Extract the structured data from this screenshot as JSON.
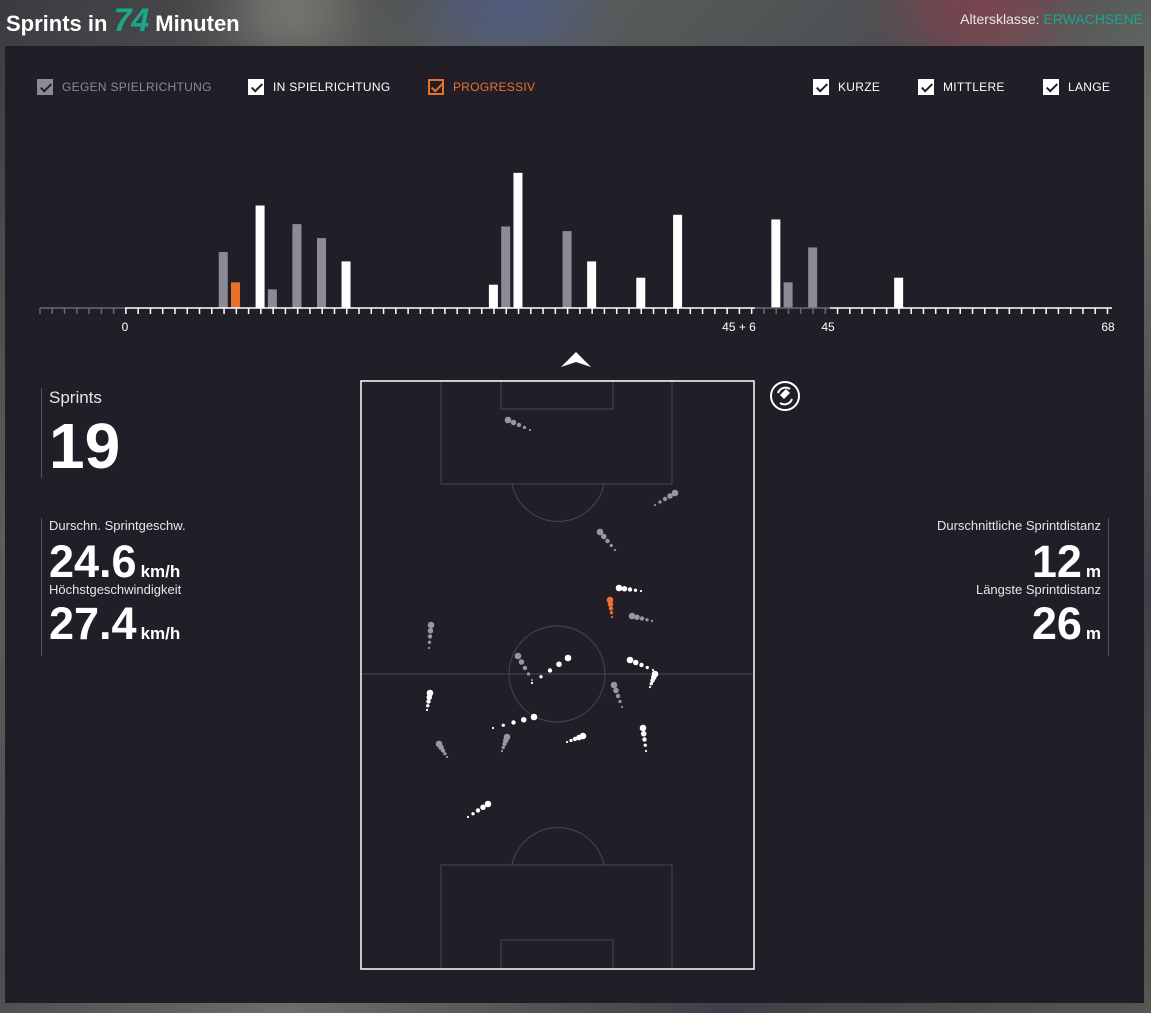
{
  "header": {
    "title_prefix": "Sprints in",
    "minutes": "74",
    "title_suffix": "Minuten",
    "age_label": "Altersklasse:",
    "age_value": "ERWACHSENE"
  },
  "filters": {
    "direction": [
      {
        "label": "GEGEN SPIELRICHTUNG",
        "checked": true,
        "color": "#8e8a95"
      },
      {
        "label": "IN SPIELRICHTUNG",
        "checked": true,
        "color": "#ffffff"
      },
      {
        "label": "PROGRESSIV",
        "checked": true,
        "color": "#e8722c"
      }
    ],
    "length": [
      {
        "label": "KURZE",
        "checked": true
      },
      {
        "label": "MITTLERE",
        "checked": true
      },
      {
        "label": "LANGE",
        "checked": true
      }
    ]
  },
  "timeline": {
    "tick_labels": [
      "0",
      "45 + 6",
      "45",
      "68"
    ],
    "colors": {
      "gegen": "#8e8a95",
      "in": "#ffffff",
      "progressiv": "#e8722c"
    },
    "sprint_bars": [
      {
        "minute": 8,
        "type": "gegen",
        "value": 12
      },
      {
        "minute": 9,
        "type": "progressiv",
        "value": 5.5
      },
      {
        "minute": 11,
        "type": "in",
        "value": 22
      },
      {
        "minute": 12,
        "type": "gegen",
        "value": 4
      },
      {
        "minute": 14,
        "type": "gegen",
        "value": 17
      },
      {
        "minute": 14,
        "type": "gegen",
        "value": 18
      },
      {
        "minute": 16,
        "type": "gegen",
        "value": 15
      },
      {
        "minute": 18,
        "type": "in",
        "value": 10
      },
      {
        "minute": 30,
        "type": "in",
        "value": 5
      },
      {
        "minute": 31,
        "type": "gegen",
        "value": 17.5
      },
      {
        "minute": 32,
        "type": "in",
        "value": 29
      },
      {
        "minute": 36,
        "type": "gegen",
        "value": 16.5
      },
      {
        "minute": 38,
        "type": "in",
        "value": 10
      },
      {
        "minute": 42,
        "type": "in",
        "value": 6.5
      },
      {
        "minute": 45,
        "type": "in",
        "value": 20
      },
      {
        "minute": 53,
        "type": "in",
        "value": 19
      },
      {
        "minute": 54,
        "type": "gegen",
        "value": 5.5
      },
      {
        "minute": 56,
        "type": "gegen",
        "value": 13
      },
      {
        "minute": 63,
        "type": "in",
        "value": 6.5
      }
    ]
  },
  "stats": {
    "sprints_label": "Sprints",
    "sprints_value": "19",
    "avg_speed_label": "Durschn. Sprintgeschw.",
    "avg_speed_value": "24.6",
    "avg_speed_unit": "km/h",
    "max_speed_label": "Höchstgeschwindigkeit",
    "max_speed_value": "27.4",
    "max_speed_unit": "km/h",
    "avg_distance_label": "Durschnittliche Sprintdistanz",
    "avg_distance_value": "12",
    "avg_distance_unit": "m",
    "longest_distance_label": "Längste Sprintdistanz",
    "longest_distance_value": "26",
    "longest_distance_unit": "m"
  },
  "pitch": {
    "icons": {
      "direction": "arrow-up-icon",
      "swap": "swap-direction-icon"
    }
  }
}
